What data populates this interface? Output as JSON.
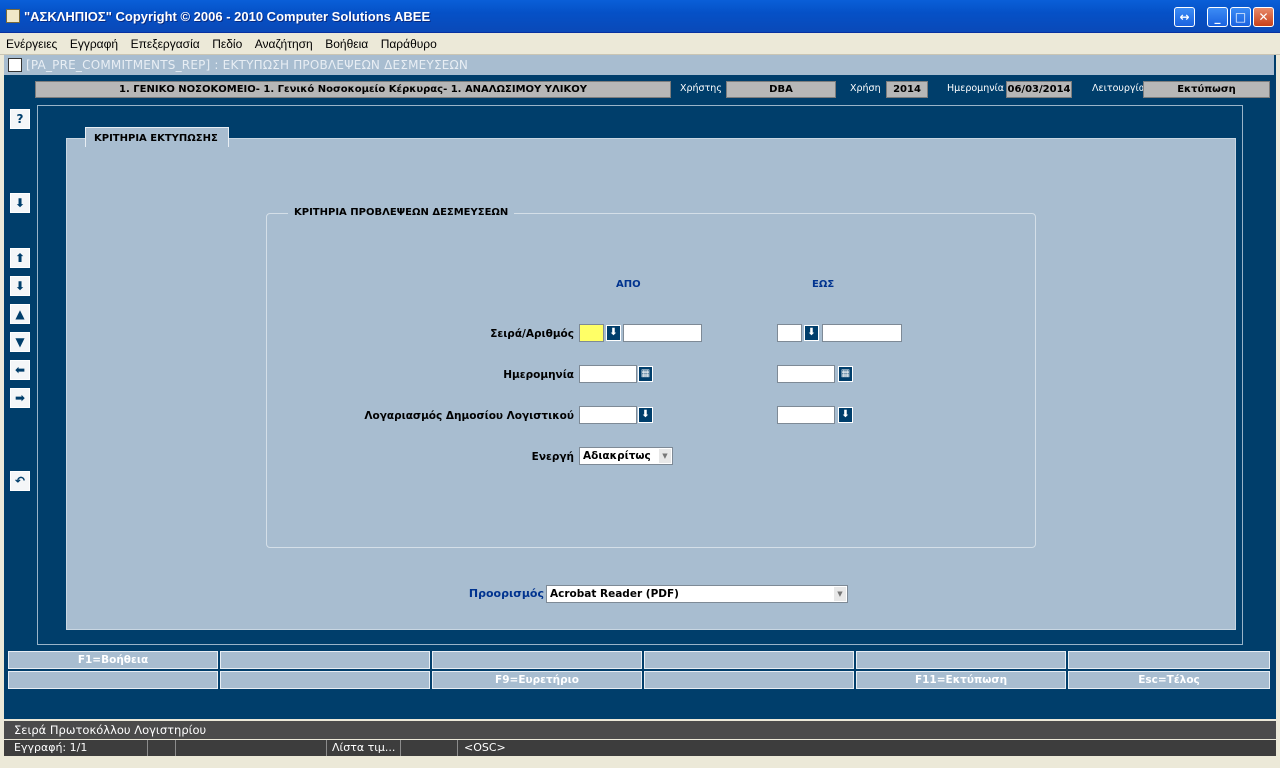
{
  "window": {
    "title": "\"ΑΣΚΛΗΠΙΟΣ\" Copyright © 2006 - 2010 Computer Solutions ABEE",
    "buttons": {
      "restore": "↔",
      "minimize": "_",
      "maximize": "□",
      "close": "✕"
    }
  },
  "menu": [
    "Ενέργειες",
    "Εγγραφή",
    "Επεξεργασία",
    "Πεδίο",
    "Αναζήτηση",
    "Βοήθεια",
    "Παράθυρο"
  ],
  "form_title": "[PA_PRE_COMMITMENTS_REP]  :  ΕΚΤΥΠΩΣΗ ΠΡΟΒΛΕΨΕΩΝ ΔΕΣΜΕΥΣΕΩΝ",
  "header": {
    "org": "1. ΓΕΝΙΚΟ ΝΟΣΟΚΟΜΕΙΟ- 1. Γενικό Νοσοκομείο Κέρκυρας- 1. ΑΝΑΛΩΣΙΜΟΥ ΥΛΙΚΟΥ",
    "user_label": "Χρήστης",
    "user": "DBA",
    "year_label": "Χρήση",
    "year": "2014",
    "date_label": "Ημερομηνία",
    "date": "06/03/2014",
    "function_label": "Λειτουργία",
    "function": "Εκτύπωση"
  },
  "left_toolbar": {
    "help": "?",
    "down_small": "⬇",
    "up": "⬆",
    "down": "⬇",
    "tri_up": "▲",
    "tri_down": "▼",
    "left": "⬅",
    "right": "➡",
    "undo": "↶"
  },
  "tab": "ΚΡΙΤΗΡΙΑ ΕΚΤΥΠΩΣΗΣ",
  "group": {
    "title": "ΚΡΙΤΗΡΙΑ  ΠΡΟΒΛΕΨΕΩΝ ΔΕΣΜΕΥΣΕΩΝ",
    "col_from": "ΑΠΟ",
    "col_to": "ΕΩΣ",
    "rows": {
      "series": "Σειρά/Αριθμός",
      "date": "Ημερομηνία",
      "account": "Λογαριασμός Δημοσίου Λογιστικού",
      "active": "Ενεργή"
    },
    "active_value": "Αδιακρίτως"
  },
  "destination": {
    "label": "Προορισμός",
    "value": "Acrobat Reader (PDF)"
  },
  "fkeys_row1": [
    "F1=Βοήθεια",
    "",
    "",
    "",
    "",
    ""
  ],
  "fkeys_row2": [
    "",
    "",
    "F9=Ευρετήριο",
    "",
    "F11=Εκτύπωση",
    "Esc=Τέλος"
  ],
  "status": {
    "hint": "Σειρά Πρωτοκόλλου Λογιστηρίου",
    "record": "Εγγραφή: 1/1",
    "list": "Λίστα τιμ...",
    "osc": "<OSC>"
  }
}
